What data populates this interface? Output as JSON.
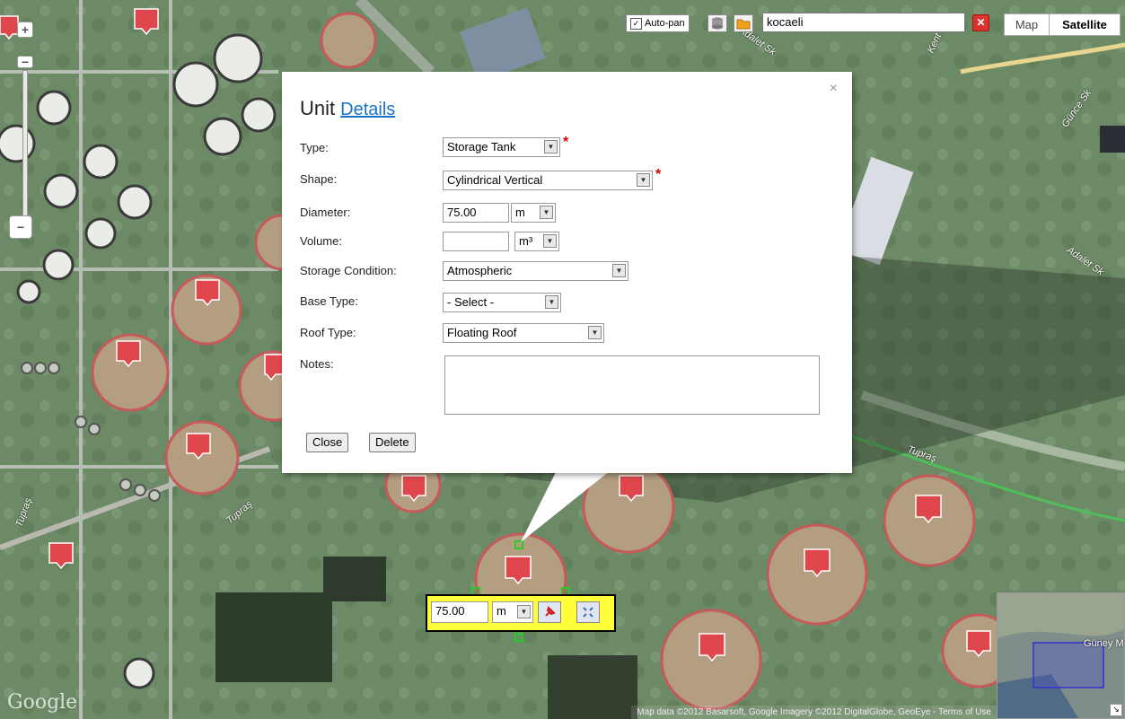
{
  "map": {
    "autopan_label": "Auto-pan",
    "autopan_checked": "✓",
    "search_value": "kocaeli",
    "clear_label": "✕",
    "map_type_map": "Map",
    "map_type_satellite": "Satellite",
    "zoom_in": "+",
    "zoom_out": "−",
    "attribution": "Map data ©2012 Basarsoft, Google Imagery ©2012 DigitalGlobe, GeoEye - Terms of Use",
    "google_logo": "Google",
    "street_labels": [
      "Adalet Sk",
      "Kent Sk",
      "Günce Sk",
      "Adalet Sk",
      "Tupraş",
      "Tupraş",
      "Tupraş",
      "Güney M"
    ]
  },
  "dialog": {
    "close_symbol": "×",
    "title": "Unit",
    "details_link": "Details",
    "fields": {
      "type_label": "Type:",
      "type_value": "Storage Tank",
      "shape_label": "Shape:",
      "shape_value": "Cylindrical Vertical",
      "diameter_label": "Diameter:",
      "diameter_value": "75.00",
      "diameter_unit": "m",
      "volume_label": "Volume:",
      "volume_value": "",
      "volume_unit": "m³",
      "storage_label": "Storage Condition:",
      "storage_value": "Atmospheric",
      "base_label": "Base Type:",
      "base_value": "- Select -",
      "roof_label": "Roof Type:",
      "roof_value": "Floating Roof",
      "notes_label": "Notes:"
    },
    "required_marker": "*",
    "close_button": "Close",
    "delete_button": "Delete"
  },
  "measure": {
    "value": "75.00",
    "unit": "m"
  },
  "colors": {
    "accent_link": "#1a73c8",
    "required": "#dd0000",
    "measure_bg": "#ffff3a",
    "tank_marker": "#e0474c"
  }
}
